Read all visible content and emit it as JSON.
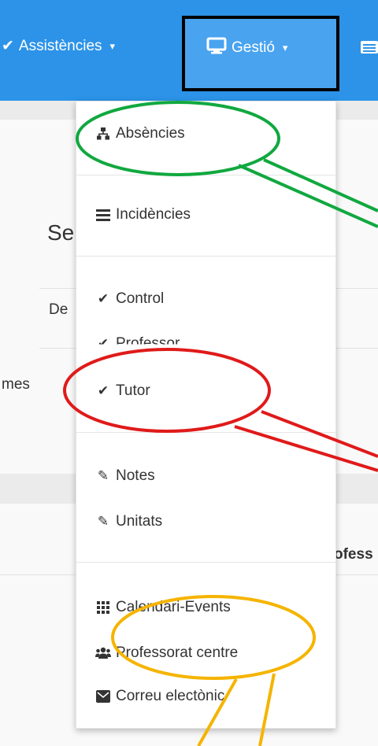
{
  "navbar": {
    "items": [
      {
        "label": "Assistències",
        "caret": "▾",
        "icon": "check-icon"
      },
      {
        "label": "Gestió",
        "caret": "▾",
        "icon": "desktop-icon"
      },
      {
        "icon": "list-icon"
      }
    ]
  },
  "background": {
    "heading_fragment": "Se",
    "label_fragment_de": "De",
    "label_fragment_mes": "mes",
    "label_fragment_profess": "ofess"
  },
  "dropdown": {
    "items": [
      {
        "label": "Absències",
        "icon": "sitemap-icon"
      },
      {
        "label": "Incidències",
        "icon": "list-icon"
      },
      {
        "label": "Control",
        "icon": "check-icon"
      },
      {
        "label": "Professor",
        "icon": "check-icon"
      },
      {
        "label": "Tutor",
        "icon": "check-icon"
      },
      {
        "label": "Notes",
        "icon": "edit-icon"
      },
      {
        "label": "Unitats",
        "icon": "edit-icon"
      },
      {
        "label": "Calendari-Events",
        "icon": "grid-icon"
      },
      {
        "label": "Professorat centre",
        "icon": "users-icon"
      },
      {
        "label": "Correu electònic",
        "icon": "envelope-icon"
      }
    ]
  },
  "annotations": {
    "green_ellipse_color": "#11a83f",
    "red_ellipse_color": "#e01a1a",
    "yellow_ellipse_color": "#f5b400",
    "active_box_color": "#000000"
  }
}
